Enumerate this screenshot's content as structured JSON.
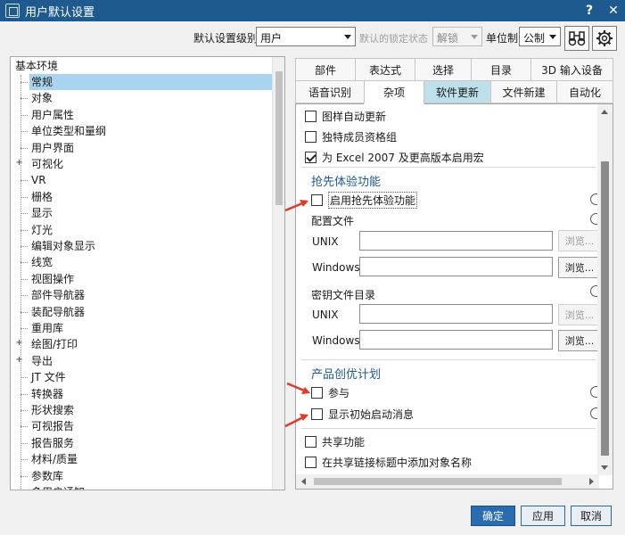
{
  "window": {
    "title": "用户默认设置",
    "help": "?",
    "close": "✕"
  },
  "toolbar": {
    "level_label": "默认设置级别",
    "level_value": "用户",
    "lock_label": "默认的锁定状态",
    "lock_value": "解锁",
    "unit_label": "单位制",
    "unit_value": "公制"
  },
  "tree": {
    "root": "基本环境",
    "items": [
      {
        "label": "常规",
        "selected": true,
        "expandable": false
      },
      {
        "label": "对象",
        "expandable": false
      },
      {
        "label": "用户属性",
        "expandable": false
      },
      {
        "label": "单位类型和量纲",
        "expandable": false
      },
      {
        "label": "用户界面",
        "expandable": false
      },
      {
        "label": "可视化",
        "expandable": true
      },
      {
        "label": "VR",
        "expandable": false
      },
      {
        "label": "栅格",
        "expandable": false
      },
      {
        "label": "显示",
        "expandable": false
      },
      {
        "label": "灯光",
        "expandable": false
      },
      {
        "label": "编辑对象显示",
        "expandable": false
      },
      {
        "label": "线宽",
        "expandable": false
      },
      {
        "label": "视图操作",
        "expandable": false
      },
      {
        "label": "部件导航器",
        "expandable": false
      },
      {
        "label": "装配导航器",
        "expandable": false
      },
      {
        "label": "重用库",
        "expandable": false
      },
      {
        "label": "绘图/打印",
        "expandable": true
      },
      {
        "label": "导出",
        "expandable": true
      },
      {
        "label": "JT 文件",
        "expandable": false
      },
      {
        "label": "转换器",
        "expandable": false
      },
      {
        "label": "形状搜索",
        "expandable": false
      },
      {
        "label": "可视报告",
        "expandable": false
      },
      {
        "label": "报告服务",
        "expandable": false
      },
      {
        "label": "材料/质量",
        "expandable": false
      },
      {
        "label": "参数库",
        "expandable": false
      },
      {
        "label": "多用户通知",
        "expandable": false
      }
    ]
  },
  "tabs": {
    "row1": [
      "部件",
      "表达式",
      "选择",
      "目录",
      "3D 输入设备"
    ],
    "row2": [
      "语音识别",
      "杂项",
      "软件更新",
      "文件新建",
      "自动化"
    ]
  },
  "panel": {
    "top_options": [
      {
        "label": "图样自动更新",
        "checked": false
      },
      {
        "label": "独特成员资格组",
        "checked": false
      },
      {
        "label": "为 Excel 2007 及更高版本启用宏",
        "checked": true
      }
    ],
    "early_access": {
      "title": "抢先体验功能",
      "enable_label": "启用抢先体验功能",
      "enable_checked": false,
      "config_label": "配置文件",
      "key_dir_label": "密钥文件目录",
      "unix_label": "UNIX",
      "windows_label": "Windows",
      "browse_label": "浏览..."
    },
    "product_program": {
      "title": "产品创优计划",
      "participate_label": "参与",
      "participate_checked": false,
      "show_msg_label": "显示初始启动消息",
      "show_msg_checked": false
    },
    "bottom_options": [
      {
        "label": "共享功能",
        "checked": false
      },
      {
        "label": "在共享链接标题中添加对象名称",
        "checked": false
      }
    ]
  },
  "buttons": {
    "ok": "确定",
    "apply": "应用",
    "cancel": "取消"
  },
  "colors": {
    "titlebar": "#1f5a8f",
    "selection": "#a9d3ee",
    "tab_highlight": "#bde0ea",
    "arrow": "#e23a2a"
  }
}
